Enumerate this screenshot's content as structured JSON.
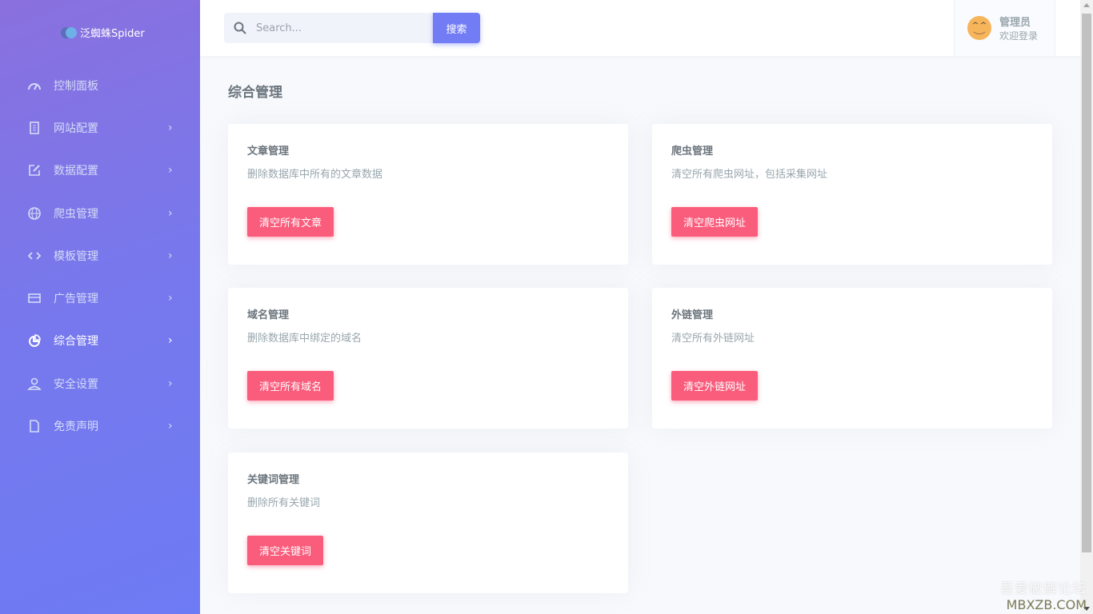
{
  "app": {
    "logo_text": "泛蜘蛛Spider"
  },
  "sidebar": {
    "items": [
      {
        "label": "控制面板",
        "icon": "gauge-icon",
        "chevron": false,
        "active": false
      },
      {
        "label": "网站配置",
        "icon": "document-icon",
        "chevron": true,
        "active": false
      },
      {
        "label": "数据配置",
        "icon": "edit-icon",
        "chevron": true,
        "active": false
      },
      {
        "label": "爬虫管理",
        "icon": "globe-icon",
        "chevron": true,
        "active": false
      },
      {
        "label": "模板管理",
        "icon": "code-icon",
        "chevron": true,
        "active": false
      },
      {
        "label": "广告管理",
        "icon": "card-icon",
        "chevron": true,
        "active": false
      },
      {
        "label": "综合管理",
        "icon": "pie-chart-icon",
        "chevron": true,
        "active": true
      },
      {
        "label": "安全设置",
        "icon": "user-icon",
        "chevron": true,
        "active": false
      },
      {
        "label": "免责声明",
        "icon": "file-icon",
        "chevron": true,
        "active": false
      }
    ]
  },
  "header": {
    "search_placeholder": "Search...",
    "search_button": "搜索",
    "user_name": "管理员",
    "user_sub": "欢迎登录"
  },
  "main": {
    "title": "综合管理",
    "cards": [
      {
        "title": "文章管理",
        "desc": "删除数据库中所有的文章数据",
        "button": "清空所有文章"
      },
      {
        "title": "爬虫管理",
        "desc": "清空所有爬虫网址，包括采集网址",
        "button": "清空爬虫网址"
      },
      {
        "title": "域名管理",
        "desc": "删除数据库中绑定的域名",
        "button": "清空所有域名"
      },
      {
        "title": "外链管理",
        "desc": "清空所有外链网址",
        "button": "清空外链网址"
      },
      {
        "title": "关键词管理",
        "desc": "删除所有关键词",
        "button": "清空关键词"
      }
    ]
  },
  "watermark": {
    "line1": "吾爱破解论坛",
    "line2": "MBXZB.COM"
  },
  "colors": {
    "accent": "#727cf5",
    "danger": "#fa5c7c"
  }
}
